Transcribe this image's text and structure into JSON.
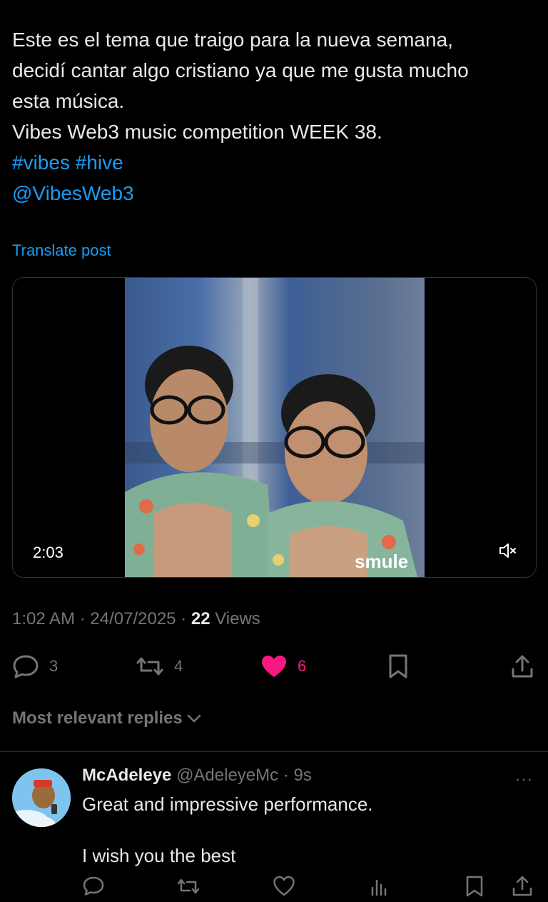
{
  "post": {
    "lines": [
      "Este es el tema que traigo para la nueva semana,",
      "decidí cantar algo cristiano ya que me gusta mucho",
      "esta música.",
      "Vibes Web3 music competition WEEK 38."
    ],
    "hashtags": "#vibes #hive",
    "mention": "@VibesWeb3",
    "translate": "Translate post"
  },
  "video": {
    "duration": "2:03",
    "watermark": "smule"
  },
  "meta": {
    "time": "1:02 AM",
    "sep1": " · ",
    "date": "24/07/2025",
    "sep2": " · ",
    "views_count": "22",
    "views_label": " Views"
  },
  "actions": {
    "replies": "3",
    "reposts": "4",
    "likes": "6",
    "like_color": "#f91880"
  },
  "replies_header": "Most relevant replies",
  "reply": {
    "name": "McAdeleye",
    "handle": "@AdeleyeMc",
    "sep": " · ",
    "time": "9s",
    "line1": "Great and impressive performance.",
    "line2": "I wish you the best",
    "more": "···"
  },
  "colors": {
    "background": "#000000",
    "link": "#1d9bf0",
    "muted": "#71767b",
    "text": "#e7e9ea"
  }
}
